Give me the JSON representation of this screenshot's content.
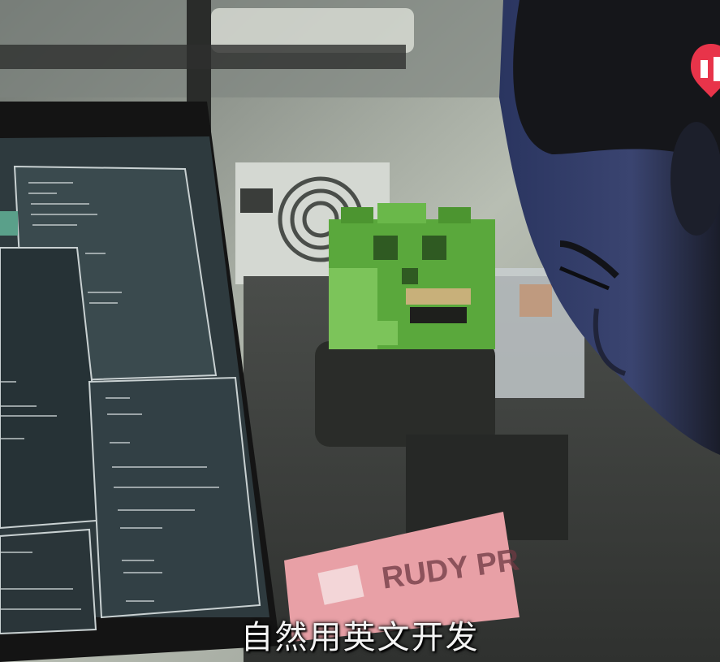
{
  "subtitle": {
    "text": "自然用英文开发"
  },
  "label_text": "RUDY PR",
  "logo": {
    "icon": "red-brand-logo-icon",
    "color": "#e8344a"
  },
  "colors": {
    "monitor_bezel": "#141414",
    "screen_terminal": "#2e3a3e",
    "screen_text": "#c9d1d2",
    "figurine_green": "#5aa83c",
    "tape_pink": "#e8a0a6"
  }
}
